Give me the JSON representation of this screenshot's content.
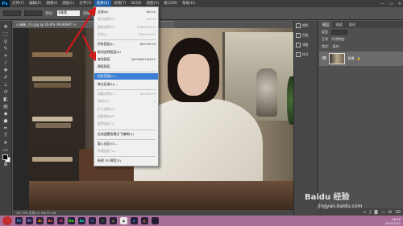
{
  "app": {
    "logo": "Ps"
  },
  "menubar": {
    "items": [
      "文件(F)",
      "编辑(E)",
      "图像(I)",
      "图层(L)",
      "文字(Y)",
      "选择(S)",
      "滤镜(T)",
      "3D(D)",
      "视图(V)",
      "窗口(W)",
      "帮助(H)"
    ],
    "active_index": 5
  },
  "window_controls": {
    "min": "—",
    "max": "▭",
    "close": "✕"
  },
  "options_bar": {
    "field_label": "羽化:",
    "field_value": "0像素",
    "btn1": "消除锯齿",
    "btn2": "调整边缘..."
  },
  "document": {
    "tab_title": "小清新_(1).jpg @ 16.8% (RGB/8#) ×",
    "status": "16.73%   文档:37.1M/37.1M"
  },
  "select_menu": {
    "items": [
      {
        "label": "全部(A)",
        "shortcut": "Ctrl+A",
        "disabled": false
      },
      {
        "label": "取消选择(D)",
        "shortcut": "Ctrl+D",
        "disabled": true
      },
      {
        "label": "重新选择(E)",
        "shortcut": "Shift+Ctrl+D",
        "disabled": true
      },
      {
        "label": "反向(I)",
        "shortcut": "Shift+Ctrl+I",
        "disabled": true
      },
      {
        "label": "所有图层(L)",
        "shortcut": "Alt+Ctrl+A",
        "disabled": false
      },
      {
        "label": "取消选择图层(S)",
        "shortcut": "",
        "disabled": false
      },
      {
        "label": "查找图层",
        "shortcut": "Alt+Shift+Ctrl+F",
        "disabled": false
      },
      {
        "label": "隔离图层",
        "shortcut": "",
        "disabled": false
      },
      {
        "label": "色彩范围(C)...",
        "shortcut": "",
        "disabled": false,
        "highlighted": true
      },
      {
        "label": "焦点区域(U)...",
        "shortcut": "",
        "disabled": false
      },
      {
        "label": "调整边缘(F)...",
        "shortcut": "Alt+Ctrl+R",
        "disabled": true
      },
      {
        "label": "修改(M)",
        "shortcut": "▸",
        "disabled": true
      },
      {
        "label": "扩大选取(G)",
        "shortcut": "",
        "disabled": true
      },
      {
        "label": "选取相似(R)",
        "shortcut": "",
        "disabled": true
      },
      {
        "label": "变换选区(T)",
        "shortcut": "",
        "disabled": true
      },
      {
        "label": "在快速蒙版模式下编辑(Q)",
        "shortcut": "",
        "disabled": false
      },
      {
        "label": "载入选区(O)...",
        "shortcut": "",
        "disabled": false
      },
      {
        "label": "存储选区(V)...",
        "shortcut": "",
        "disabled": true
      },
      {
        "label": "新建 3D 模型(3)",
        "shortcut": "",
        "disabled": false
      }
    ]
  },
  "right_panel": {
    "icon_panels": [
      "颜色",
      "色板",
      "调整",
      "样式"
    ],
    "layer_tabs": [
      "图层",
      "通道",
      "路径"
    ],
    "kind_label": "类型",
    "blend_mode": "正常",
    "opacity_label": "不透明度:",
    "lock_label": "锁定:",
    "fill_label": "填充:",
    "layer_name": "背景"
  },
  "tools": [
    "移动",
    "选框",
    "套索",
    "快速选择",
    "裁剪",
    "吸管",
    "修复",
    "画笔",
    "图章",
    "历史",
    "橡皮",
    "渐变",
    "模糊",
    "减淡",
    "钢笔",
    "文字",
    "路径选择",
    "形状",
    "抓手",
    "缩放"
  ],
  "taskbar": {
    "apps": [
      {
        "label": "Ps",
        "color": "#31a8ff"
      },
      {
        "label": "Pr",
        "color": "#9999ff"
      },
      {
        "label": "Ai",
        "color": "#ff9a00"
      },
      {
        "label": "An",
        "color": "#ff5c3b"
      },
      {
        "label": "Id",
        "color": "#ff3366"
      },
      {
        "label": "Dw",
        "color": "#35fa00"
      },
      {
        "label": "Au",
        "color": "#00e4bb"
      },
      {
        "label": "W",
        "color": "#2b579a"
      },
      {
        "label": "✉",
        "color": "#1aad19"
      },
      {
        "label": "◎",
        "color": "#dcdc4a"
      },
      {
        "label": "◉",
        "color": "#e8e8e8"
      },
      {
        "label": "e",
        "color": "#1c8de0"
      },
      {
        "label": "◐",
        "color": "#f07b14"
      },
      {
        "label": "Q",
        "color": "#111111"
      }
    ]
  },
  "clock": {
    "time": "18:09",
    "date": "2019/7/22"
  },
  "watermark": {
    "logo": "Baidu 经验",
    "url": "jingyan.baidu.com"
  },
  "colors": {
    "accent": "#3c7fd4",
    "taskbar": "#a86f9a",
    "arrow": "#d11a1a"
  }
}
